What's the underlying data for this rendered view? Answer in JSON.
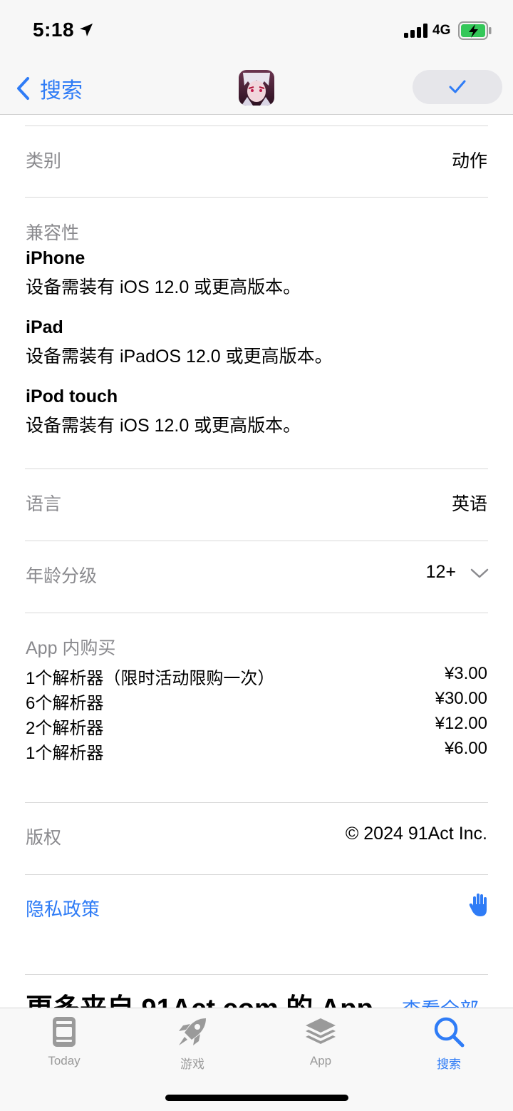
{
  "status_bar": {
    "time": "5:18",
    "network": "4G"
  },
  "nav": {
    "back_label": "搜索"
  },
  "info": {
    "category": {
      "label": "类别",
      "value": "动作"
    },
    "compatibility": {
      "label": "兼容性",
      "devices": [
        {
          "name": "iPhone",
          "requirement": "设备需装有 iOS 12.0 或更高版本。"
        },
        {
          "name": "iPad",
          "requirement": "设备需装有 iPadOS 12.0 或更高版本。"
        },
        {
          "name": "iPod touch",
          "requirement": "设备需装有 iOS 12.0 或更高版本。"
        }
      ]
    },
    "language": {
      "label": "语言",
      "value": "英语"
    },
    "age_rating": {
      "label": "年龄分级",
      "value": "12+"
    },
    "iap": {
      "label": "App 内购买",
      "items": [
        {
          "name": "1个解析器（限时活动限购一次）",
          "price": "¥3.00"
        },
        {
          "name": "6个解析器",
          "price": "¥30.00"
        },
        {
          "name": "2个解析器",
          "price": "¥12.00"
        },
        {
          "name": "1个解析器",
          "price": "¥6.00"
        }
      ]
    },
    "copyright": {
      "label": "版权",
      "value": "© 2024 91Act Inc."
    },
    "privacy": {
      "label": "隐私政策"
    }
  },
  "more_section": {
    "title": "更多来自 91Act.com 的 App",
    "see_all": "查看全部"
  },
  "tabs": [
    {
      "label": "Today",
      "icon": "today-icon"
    },
    {
      "label": "游戏",
      "icon": "rocket-icon"
    },
    {
      "label": "App",
      "icon": "stack-icon"
    },
    {
      "label": "搜索",
      "icon": "search-icon"
    }
  ],
  "colors": {
    "accent": "#2f7cf6",
    "secondary_text": "#8a8a8e"
  }
}
